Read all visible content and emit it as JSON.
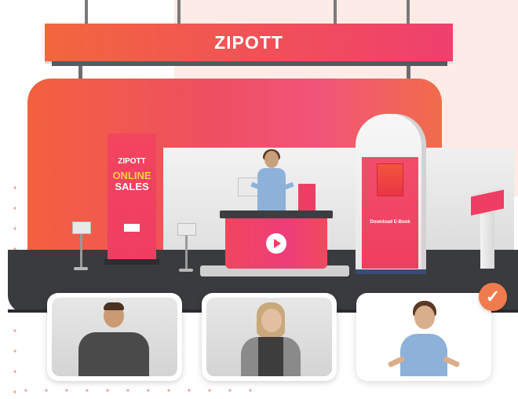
{
  "booth": {
    "banner_title": "ZIPOTT",
    "rollup": {
      "brand": "ZIPOTT",
      "line1": "ONLINE",
      "line2": "SALES"
    },
    "tower_screen_text": "Download E-Book",
    "counter_play_icon": "play-icon"
  },
  "avatars": {
    "selected_index": 2,
    "options": [
      {
        "id": "male-grey-polo",
        "shirt_color": "#4a4a4a",
        "hair_color": "#4a3222"
      },
      {
        "id": "female-blonde-blazer",
        "shirt_color": "#8a8a8a",
        "hair_color": "#c9a97a"
      },
      {
        "id": "female-blue-shirt",
        "shirt_color": "#8db1d9",
        "hair_color": "#5a3a24"
      }
    ],
    "selected_icon": "checkmark-icon"
  },
  "colors": {
    "accent": "#ef3e63",
    "orange": "#f2663e",
    "check_badge": "#f07b4e"
  }
}
